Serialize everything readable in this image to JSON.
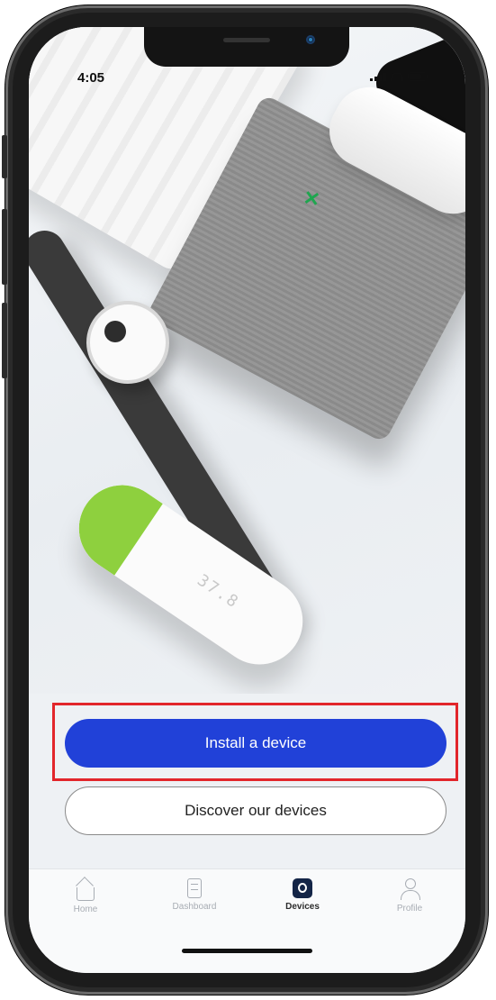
{
  "status_bar": {
    "time": "4:05"
  },
  "hero": {
    "thermometer_display": "37.8"
  },
  "actions": {
    "install_label": "Install a device",
    "discover_label": "Discover our devices"
  },
  "tabs": [
    {
      "label": "Home",
      "icon": "home-icon"
    },
    {
      "label": "Dashboard",
      "icon": "dashboard-icon"
    },
    {
      "label": "Devices",
      "icon": "devices-icon",
      "active": true
    },
    {
      "label": "Profile",
      "icon": "profile-icon"
    }
  ],
  "colors": {
    "primary": "#2141d8",
    "highlight": "#e2262b",
    "active_tab_icon": "#142547"
  }
}
